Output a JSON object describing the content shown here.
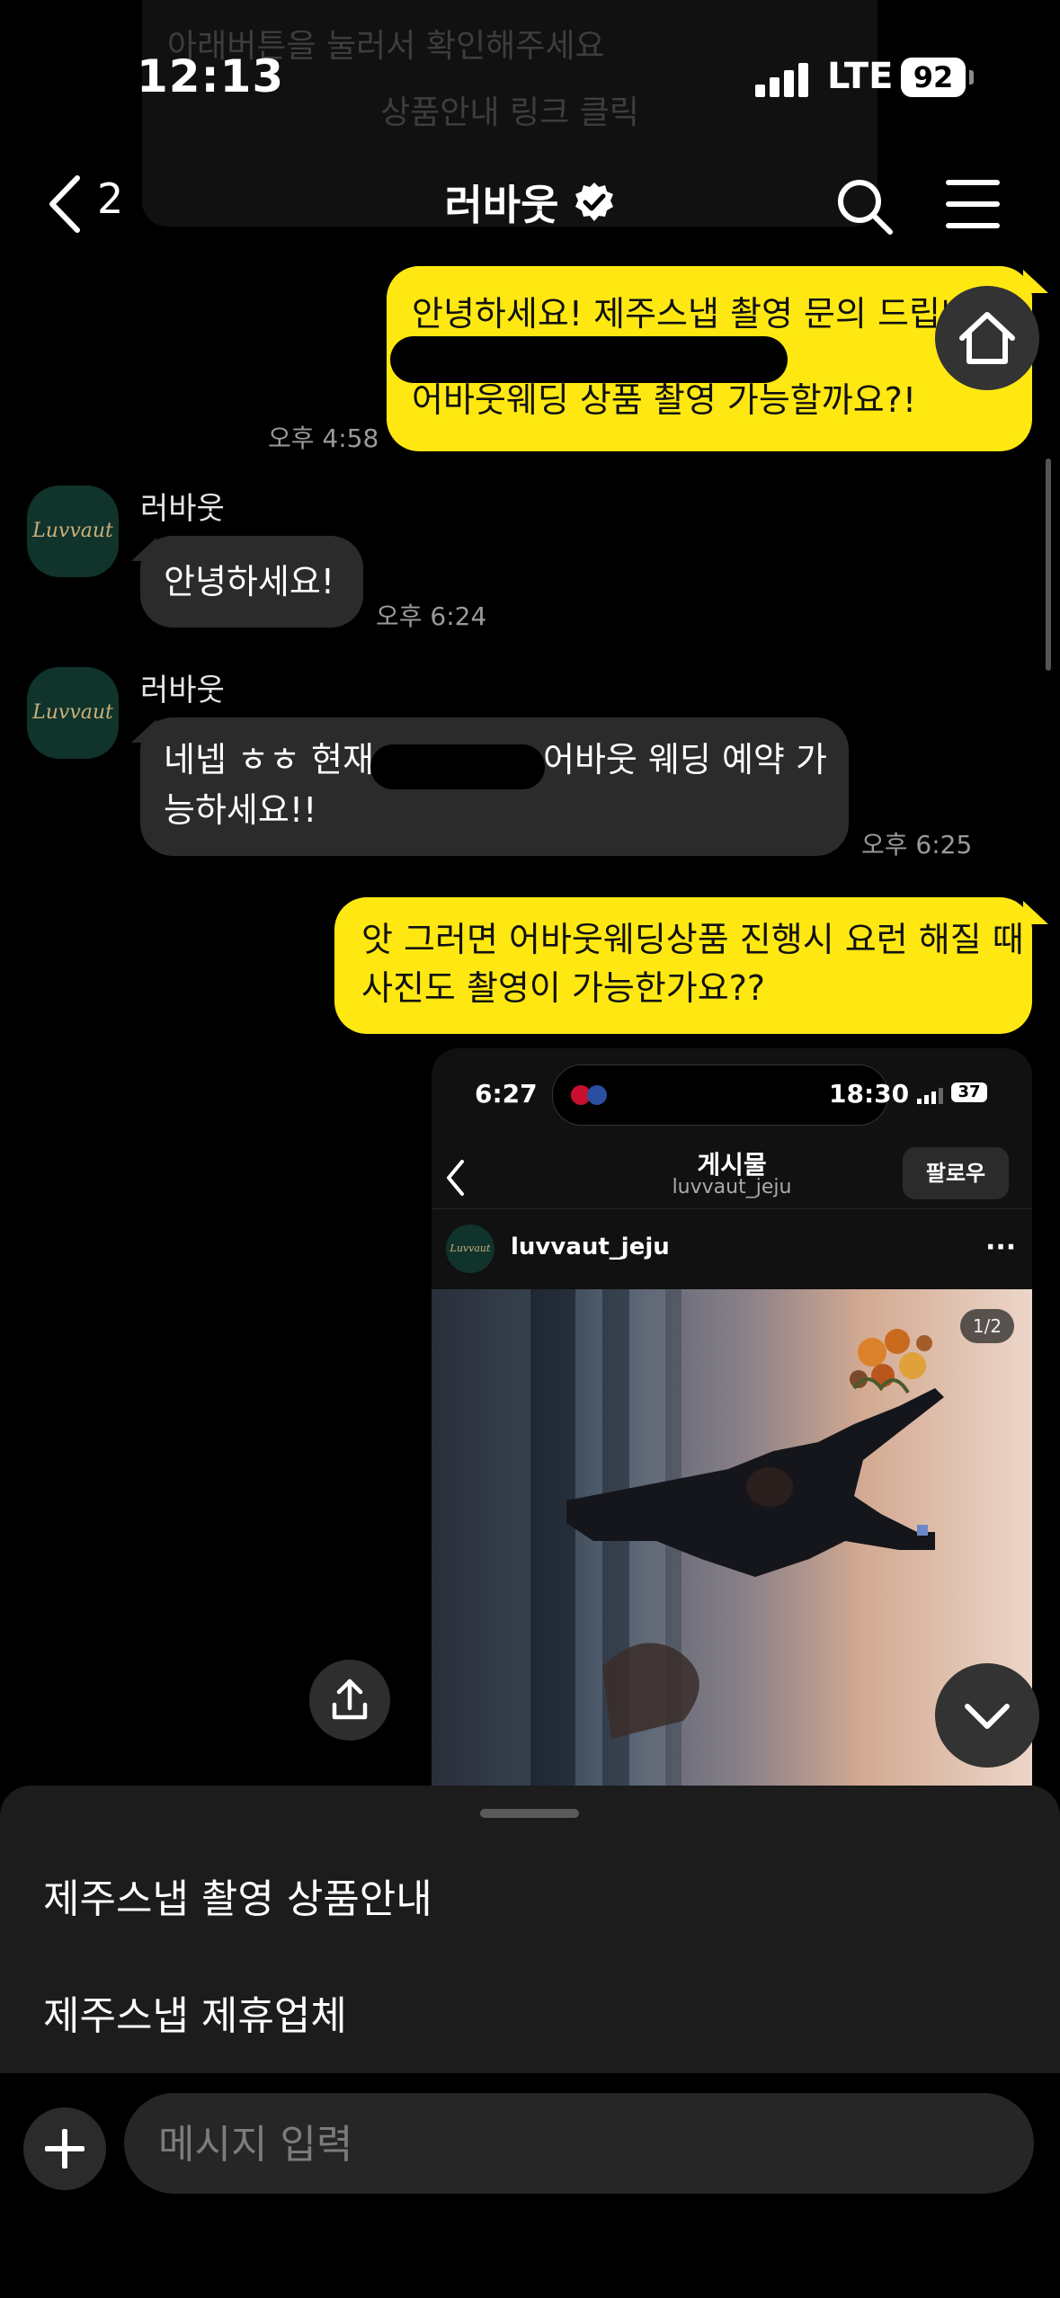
{
  "status_bar": {
    "time": "12:13",
    "network": "LTE",
    "battery": "92"
  },
  "background_notice": {
    "line1": "아래버튼을 눌러서 확인해주세요",
    "link": "상품안내 링크 클릭"
  },
  "header": {
    "back_count": "2",
    "title": "러바웃"
  },
  "messages": [
    {
      "side": "me",
      "line1": "안녕하세요! 제주스냅 촬영 문의 드립니다",
      "line2": "어바웃웨딩 상품 촬영 가능할까요?!",
      "time": "오후 4:58"
    },
    {
      "side": "them",
      "sender": "러바웃",
      "text": "안녕하세요!",
      "time": "오후 6:24"
    },
    {
      "side": "them",
      "sender": "러바웃",
      "line1_pre": "네넵 ㅎㅎ 현재",
      "line1_post": "어바웃 웨딩 예약 가",
      "line2": "능하세요!!",
      "time": "오후 6:25"
    },
    {
      "side": "me",
      "line1": "앗 그러면 어바웃웨딩상품 진행시 요런 해질 때",
      "line2": "사진도 촬영이 가능한가요??"
    }
  ],
  "shared_screenshot": {
    "time_left": "6:27",
    "time_right": "18:30",
    "battery": "37",
    "title": "게시물",
    "handle": "luvvaut_jeju",
    "follow": "팔로우",
    "username": "luvvaut_jeju",
    "more": "···",
    "pager": "1/2"
  },
  "avatar_text": "Luvvaut",
  "quick_replies": [
    "제주스냅 촬영 상품안내",
    "제주스냅 제휴업체"
  ],
  "input": {
    "placeholder": "메시지 입력"
  },
  "colors": {
    "my_bubble": "#ffe812",
    "their_bubble": "#2b2b2b",
    "background": "#000000"
  },
  "icons": [
    "back-chevron-icon",
    "verified-badge-icon",
    "search-icon",
    "hamburger-menu-icon",
    "home-icon",
    "share-icon",
    "chevron-down-icon",
    "plus-icon"
  ]
}
